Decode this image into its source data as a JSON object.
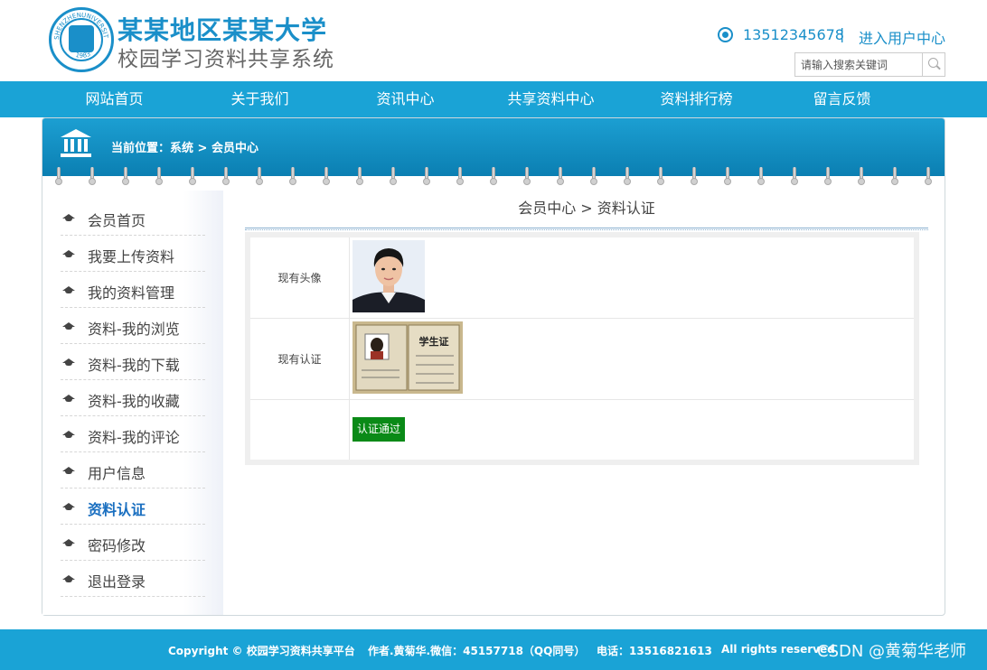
{
  "header": {
    "seal_text": [
      "SHENZHEN",
      "UNIVERSITY",
      "1983"
    ],
    "title_line1": "某某地区某某大学",
    "title_line2": "校园学习资料共享系统",
    "phone": "13512345678",
    "separator": "|",
    "user_center_link": "进入用户中心",
    "search_placeholder": "请输入搜索关键词"
  },
  "nav": {
    "items": [
      "网站首页",
      "关于我们",
      "资讯中心",
      "共享资料中心",
      "资料排行榜",
      "留言反馈"
    ]
  },
  "banner": {
    "breadcrumb": "当前位置：系统 > 会员中心"
  },
  "sidebar": {
    "items": [
      {
        "label": "会员首页"
      },
      {
        "label": "我要上传资料"
      },
      {
        "label": "我的资料管理"
      },
      {
        "label": "资料-我的浏览"
      },
      {
        "label": "资料-我的下载"
      },
      {
        "label": "资料-我的收藏"
      },
      {
        "label": "资料-我的评论"
      },
      {
        "label": "用户信息"
      },
      {
        "label": "资料认证"
      },
      {
        "label": "密码修改"
      },
      {
        "label": "退出登录"
      }
    ],
    "active_index": 8
  },
  "content": {
    "title": "会员中心 > 资料认证",
    "rows": [
      {
        "label": "现有头像"
      },
      {
        "label": "现有认证"
      },
      {
        "label": ""
      }
    ],
    "cert_card_text": "学生证",
    "verify_status": "认证通过"
  },
  "footer": {
    "copyright": "Copyright © 校园学习资料共享平台",
    "author": "作者.黄菊华.微信：45157718（QQ同号）",
    "phone": "电话：13516821613",
    "rights": "All rights reserved",
    "watermark": "CSDN @黄菊华老师"
  },
  "colors": {
    "primary": "#1aa3d6",
    "brand_text": "#1a8fc9",
    "active_link": "#1a6fc0",
    "verify_green": "#0a8a17"
  },
  "icons": {
    "phone": "phone-circle-icon",
    "search": "search-icon",
    "home": "building-icon",
    "sidebar": "graduation-cap-icon"
  }
}
